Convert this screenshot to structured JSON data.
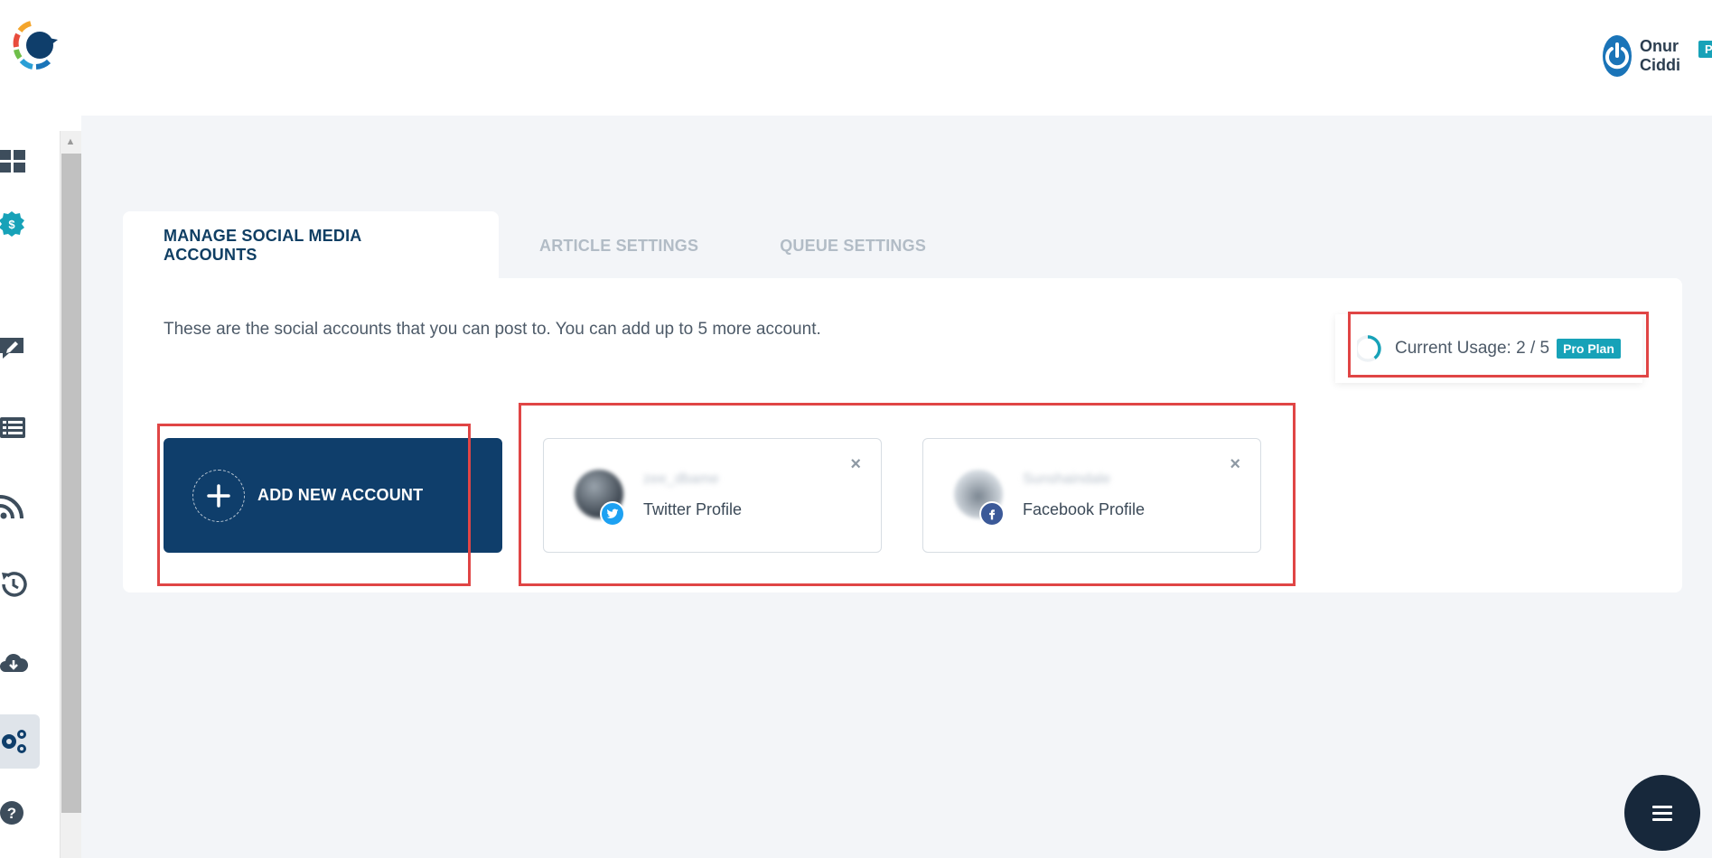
{
  "header": {
    "user_name": "Onur Ciddi",
    "user_badge": "Pro"
  },
  "sidebar": {
    "items": [
      {
        "icon": "dashboard-icon"
      },
      {
        "icon": "dollar-badge-icon"
      },
      {
        "icon": "edit-comment-icon"
      },
      {
        "icon": "list-icon"
      },
      {
        "icon": "rss-icon"
      },
      {
        "icon": "history-icon"
      },
      {
        "icon": "cloud-download-icon"
      },
      {
        "icon": "gears-icon",
        "active": true
      },
      {
        "icon": "help-icon"
      }
    ]
  },
  "tabs": [
    {
      "label": "MANAGE SOCIAL MEDIA ACCOUNTS",
      "active": true
    },
    {
      "label": "ARTICLE SETTINGS",
      "active": false
    },
    {
      "label": "QUEUE SETTINGS",
      "active": false
    }
  ],
  "main": {
    "description": "These are the social accounts that you can post to. You can add up to 5 more account.",
    "usage": {
      "label": "Current Usage: 2 / 5",
      "used": 2,
      "total": 5,
      "plan_badge": "Pro Plan"
    },
    "add_button_label": "ADD NEW ACCOUNT",
    "accounts": [
      {
        "name": "zee_dbame",
        "type_label": "Twitter Profile",
        "network": "twitter",
        "color": "#1da1f2"
      },
      {
        "name": "Sunshaindale",
        "type_label": "Facebook Profile",
        "network": "facebook",
        "color": "#3b5998"
      }
    ]
  },
  "colors": {
    "primary": "#0f3e6b",
    "accent": "#17a2b8",
    "highlight": "#e04545"
  }
}
